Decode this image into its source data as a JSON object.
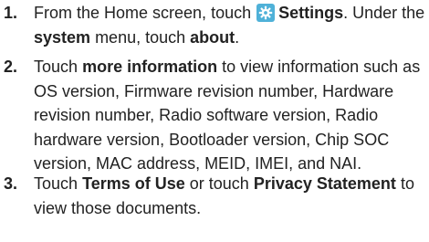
{
  "steps": [
    {
      "number": "1.",
      "parts": {
        "a": "From the Home screen, touch",
        "b": "Settings",
        "c": ". Under the",
        "d": "system",
        "e": "menu, touch",
        "f": "about",
        "g": "."
      },
      "icon": "settings-gear-icon"
    },
    {
      "number": "2.",
      "parts": {
        "a": "Touch",
        "b": "more information",
        "c": "to view information such as OS version, Firmware revision number, Hardware revision number, Radio software version, Radio hardware version, Bootloader version, Chip SOC version, MAC address, MEID, IMEI, and NAI."
      }
    },
    {
      "number": "3.",
      "parts": {
        "a": "Touch",
        "b": "Terms of Use",
        "c": "or touch",
        "d": "Privacy Statement",
        "e": "to view those documents."
      }
    }
  ],
  "colors": {
    "text": "#222222",
    "icon_bg": "#4fb1d8"
  }
}
